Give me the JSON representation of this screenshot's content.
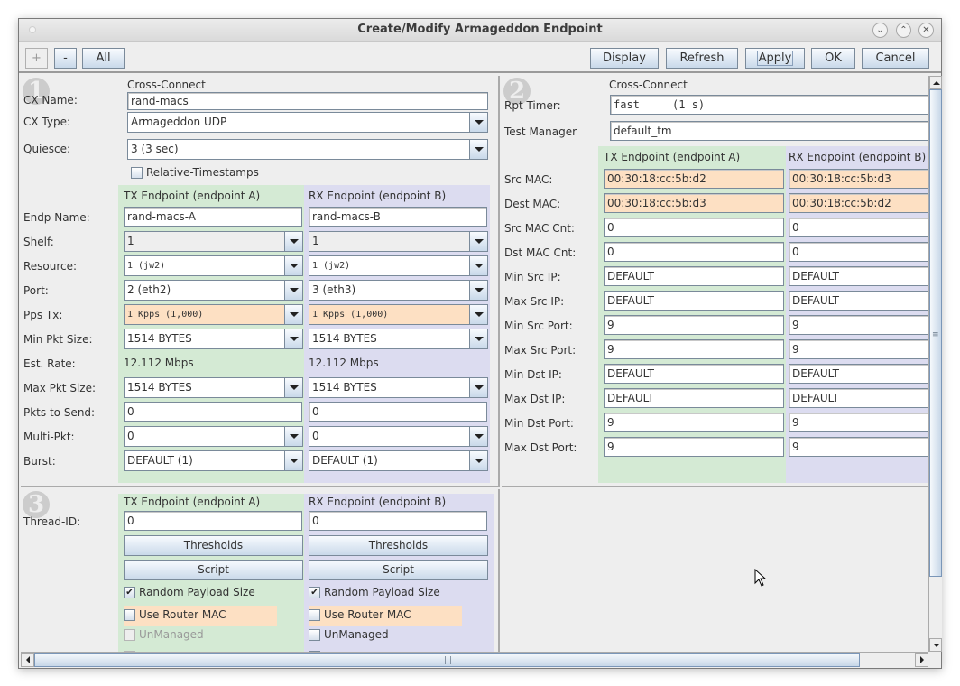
{
  "window": {
    "title": "Create/Modify Armageddon Endpoint",
    "controls": {
      "minimize": "⌄",
      "maximize": "⌃",
      "close": "✕"
    }
  },
  "toolbar": {
    "plus_label": "+",
    "minus_label": "-",
    "all_label": "All",
    "display_label": "Display",
    "refresh_label": "Refresh",
    "apply_label": "Apply",
    "ok_label": "OK",
    "cancel_label": "Cancel"
  },
  "panel1": {
    "badge": "1",
    "cross_connect_header": "Cross-Connect",
    "cx_name_label": "CX Name:",
    "cx_name_value": "rand-macs",
    "cx_type_label": "CX Type:",
    "cx_type_value": "Armageddon UDP",
    "quiesce_label": "Quiesce:",
    "quiesce_value": "3 (3 sec)",
    "relative_timestamps_label": "Relative-Timestamps",
    "relative_timestamps_checked": false,
    "tx_header": "TX Endpoint (endpoint A)",
    "rx_header": "RX Endpoint (endpoint B)",
    "rows": {
      "endp_name": {
        "label": "Endp Name:",
        "tx": "rand-macs-A",
        "rx": "rand-macs-B"
      },
      "shelf": {
        "label": "Shelf:",
        "tx": "1",
        "rx": "1"
      },
      "resource": {
        "label": "Resource:",
        "tx": "1 (jw2)",
        "rx": "1 (jw2)"
      },
      "port": {
        "label": "Port:",
        "tx": "2 (eth2)",
        "rx": "3 (eth3)"
      },
      "pps_tx": {
        "label": "Pps Tx:",
        "tx": "1 Kpps (1,000)",
        "rx": "1 Kpps (1,000)"
      },
      "min_pkt_size": {
        "label": "Min Pkt Size:",
        "tx": "1514 BYTES",
        "rx": "1514 BYTES"
      },
      "est_rate": {
        "label": "Est. Rate:",
        "tx": "12.112 Mbps",
        "rx": "12.112 Mbps"
      },
      "max_pkt_size": {
        "label": "Max Pkt Size:",
        "tx": "1514 BYTES",
        "rx": "1514 BYTES"
      },
      "pkts_to_send": {
        "label": "Pkts to Send:",
        "tx": "0",
        "rx": "0"
      },
      "multi_pkt": {
        "label": "Multi-Pkt:",
        "tx": "0",
        "rx": "0"
      },
      "burst": {
        "label": "Burst:",
        "tx": "DEFAULT (1)",
        "rx": "DEFAULT (1)"
      }
    }
  },
  "panel2": {
    "badge": "2",
    "cross_connect_header": "Cross-Connect",
    "rpt_timer_label": "Rpt Timer:",
    "rpt_timer_value": "fast     (1 s)",
    "test_manager_label": "Test Manager",
    "test_manager_value": "default_tm",
    "tx_header": "TX Endpoint (endpoint A)",
    "rx_header": "RX Endpoint (endpoint B)",
    "rows": [
      {
        "label": "Src MAC:",
        "tx": "00:30:18:cc:5b:d2",
        "rx": "00:30:18:cc:5b:d3"
      },
      {
        "label": "Dest MAC:",
        "tx": "00:30:18:cc:5b:d3",
        "rx": "00:30:18:cc:5b:d2"
      },
      {
        "label": "Src MAC Cnt:",
        "tx": "0",
        "rx": "0"
      },
      {
        "label": "Dst MAC Cnt:",
        "tx": "0",
        "rx": "0"
      },
      {
        "label": "Min Src IP:",
        "tx": "DEFAULT",
        "rx": "DEFAULT"
      },
      {
        "label": "Max Src IP:",
        "tx": "DEFAULT",
        "rx": "DEFAULT"
      },
      {
        "label": "Min Src Port:",
        "tx": "9",
        "rx": "9"
      },
      {
        "label": "Max Src Port:",
        "tx": "9",
        "rx": "9"
      },
      {
        "label": "Min Dst IP:",
        "tx": "DEFAULT",
        "rx": "DEFAULT"
      },
      {
        "label": "Max Dst IP:",
        "tx": "DEFAULT",
        "rx": "DEFAULT"
      },
      {
        "label": "Min Dst Port:",
        "tx": "9",
        "rx": "9"
      },
      {
        "label": "Max Dst Port:",
        "tx": "9",
        "rx": "9"
      }
    ]
  },
  "panel3": {
    "badge": "3",
    "tx_header": "TX Endpoint (endpoint A)",
    "rx_header": "RX Endpoint (endpoint B)",
    "thread_id_label": "Thread-ID:",
    "thread_id_tx": "0",
    "thread_id_rx": "0",
    "thresholds_label": "Thresholds",
    "script_label": "Script",
    "random_payload_label": "Random Payload Size",
    "random_payload_tx": true,
    "random_payload_rx": true,
    "use_router_mac_label": "Use Router MAC",
    "use_router_mac_tx": false,
    "use_router_mac_rx": false,
    "unmanaged_label": "UnManaged",
    "unmanaged_tx": false,
    "unmanaged_rx": false
  },
  "colors": {
    "tx_column": "#d4ead4",
    "rx_column": "#dcdcf0",
    "highlight_orange": "#fde0c3",
    "window_bg": "#eeeeee"
  }
}
